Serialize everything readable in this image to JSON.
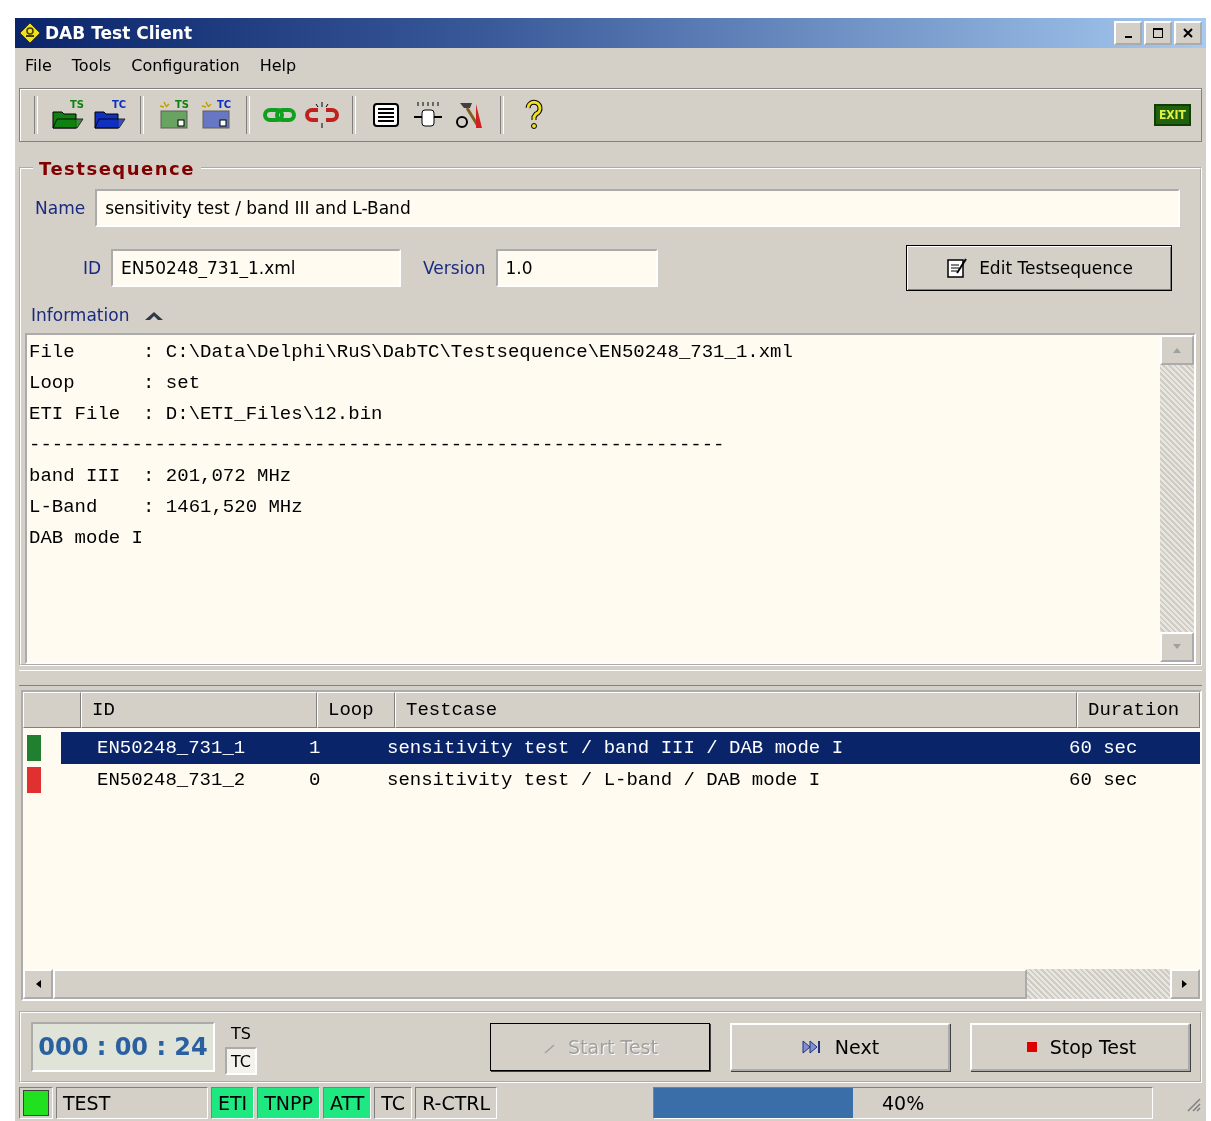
{
  "window": {
    "title": "DAB Test Client"
  },
  "menu": [
    "File",
    "Tools",
    "Configuration",
    "Help"
  ],
  "toolbar": {
    "groups": [
      [
        {
          "kind": "open",
          "badge": "TS",
          "color": "#108010"
        },
        {
          "kind": "open",
          "badge": "TC",
          "color": "#1030c0"
        }
      ],
      [
        {
          "kind": "new",
          "badge": "TS",
          "color": "#108010"
        },
        {
          "kind": "new",
          "badge": "TC",
          "color": "#1030c0"
        }
      ],
      [
        {
          "kind": "connect"
        },
        {
          "kind": "disconnect"
        }
      ],
      [
        {
          "kind": "list"
        },
        {
          "kind": "plug"
        },
        {
          "kind": "tools"
        }
      ],
      [
        {
          "kind": "help"
        }
      ]
    ],
    "exit": "EXIT"
  },
  "testsequence": {
    "title": "Testsequence",
    "name_label": "Name",
    "name": "sensitivity test / band III and L-Band",
    "id_label": "ID",
    "id": "EN50248_731_1.xml",
    "version_label": "Version",
    "version": "1.0",
    "edit_button": "Edit Testsequence",
    "info_label": "Information",
    "info_expanded": true,
    "info_lines": [
      "File      : C:\\Data\\Delphi\\RuS\\DabTC\\Testsequence\\EN50248_731_1.xml",
      "Loop      : set",
      "ETI File  : D:\\ETI_Files\\12.bin",
      "-------------------------------------------------------------",
      "band III  : 201,072 MHz",
      "L-Band    : 1461,520 MHz",
      "DAB mode I"
    ]
  },
  "table": {
    "columns": [
      "ID",
      "Loop",
      "Testcase",
      "Duration"
    ],
    "rows": [
      {
        "color": "#208030",
        "id": "EN50248_731_1",
        "loop": "1",
        "testcase": "sensitivity test / band III / DAB mode I",
        "duration": "60 sec",
        "selected": true
      },
      {
        "color": "#e03030",
        "id": "EN50248_731_2",
        "loop": "0",
        "testcase": "sensitivity test / L-band / DAB mode I",
        "duration": "60 sec",
        "selected": false
      }
    ]
  },
  "timer": "000 : 00 : 24",
  "mode_toggle": [
    {
      "label": "TS",
      "selected": false
    },
    {
      "label": "TC",
      "selected": true
    }
  ],
  "buttons": [
    {
      "kind": "start",
      "label": "Start Test",
      "disabled": true
    },
    {
      "kind": "next",
      "label": "Next",
      "disabled": false
    },
    {
      "kind": "stop",
      "label": "Stop Test",
      "disabled": false
    }
  ],
  "status_bar": {
    "led_on": true,
    "mode": "TEST",
    "indicators": [
      {
        "label": "ETI",
        "on": true
      },
      {
        "label": "TNPP",
        "on": true
      },
      {
        "label": "ATT",
        "on": true
      },
      {
        "label": "TC",
        "on": false
      },
      {
        "label": "R-CTRL",
        "on": false
      }
    ],
    "progress": {
      "level": 0.4,
      "text": "40%"
    }
  }
}
